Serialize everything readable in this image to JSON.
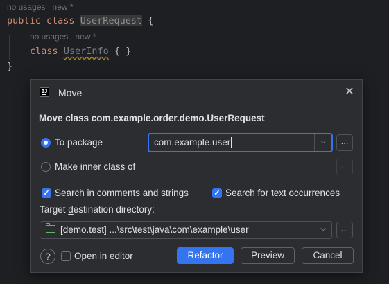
{
  "editor": {
    "hint1": {
      "usages": "no usages",
      "new": "new *"
    },
    "line1": {
      "kw1": "public",
      "kw2": "class",
      "name": "UserRequest",
      "brace": " {"
    },
    "hint2": {
      "usages": "no usages",
      "new": "new *"
    },
    "line2": {
      "kw": "class",
      "name": "UserInfo",
      "rest": " { }"
    },
    "line3": "}"
  },
  "dialog": {
    "title": "Move",
    "close_icon": "close-icon",
    "heading": "Move class com.example.order.demo.UserRequest",
    "to_package": {
      "label": "To package",
      "selected": true,
      "value": "com.example.user"
    },
    "inner_class": {
      "label": "Make inner class of",
      "selected": false
    },
    "browse_label": "...",
    "search_comments": {
      "label": "Search in comments and strings",
      "checked": true
    },
    "search_text": {
      "label": "Search for text occurrences",
      "checked": true
    },
    "target_dir_label": {
      "pre": "Target ",
      "mnemonic": "d",
      "post": "estination directory:"
    },
    "target_dir_value": "[demo.test] ...\\src\\test\\java\\com\\example\\user",
    "open_in_editor": {
      "label": "Open in editor",
      "checked": false
    },
    "help_label": "?",
    "buttons": {
      "refactor": "Refactor",
      "preview": "Preview",
      "cancel": "Cancel"
    }
  },
  "colors": {
    "accent": "#3574f0",
    "keyword": "#cf8e6d",
    "folder": "#5fb85f"
  }
}
